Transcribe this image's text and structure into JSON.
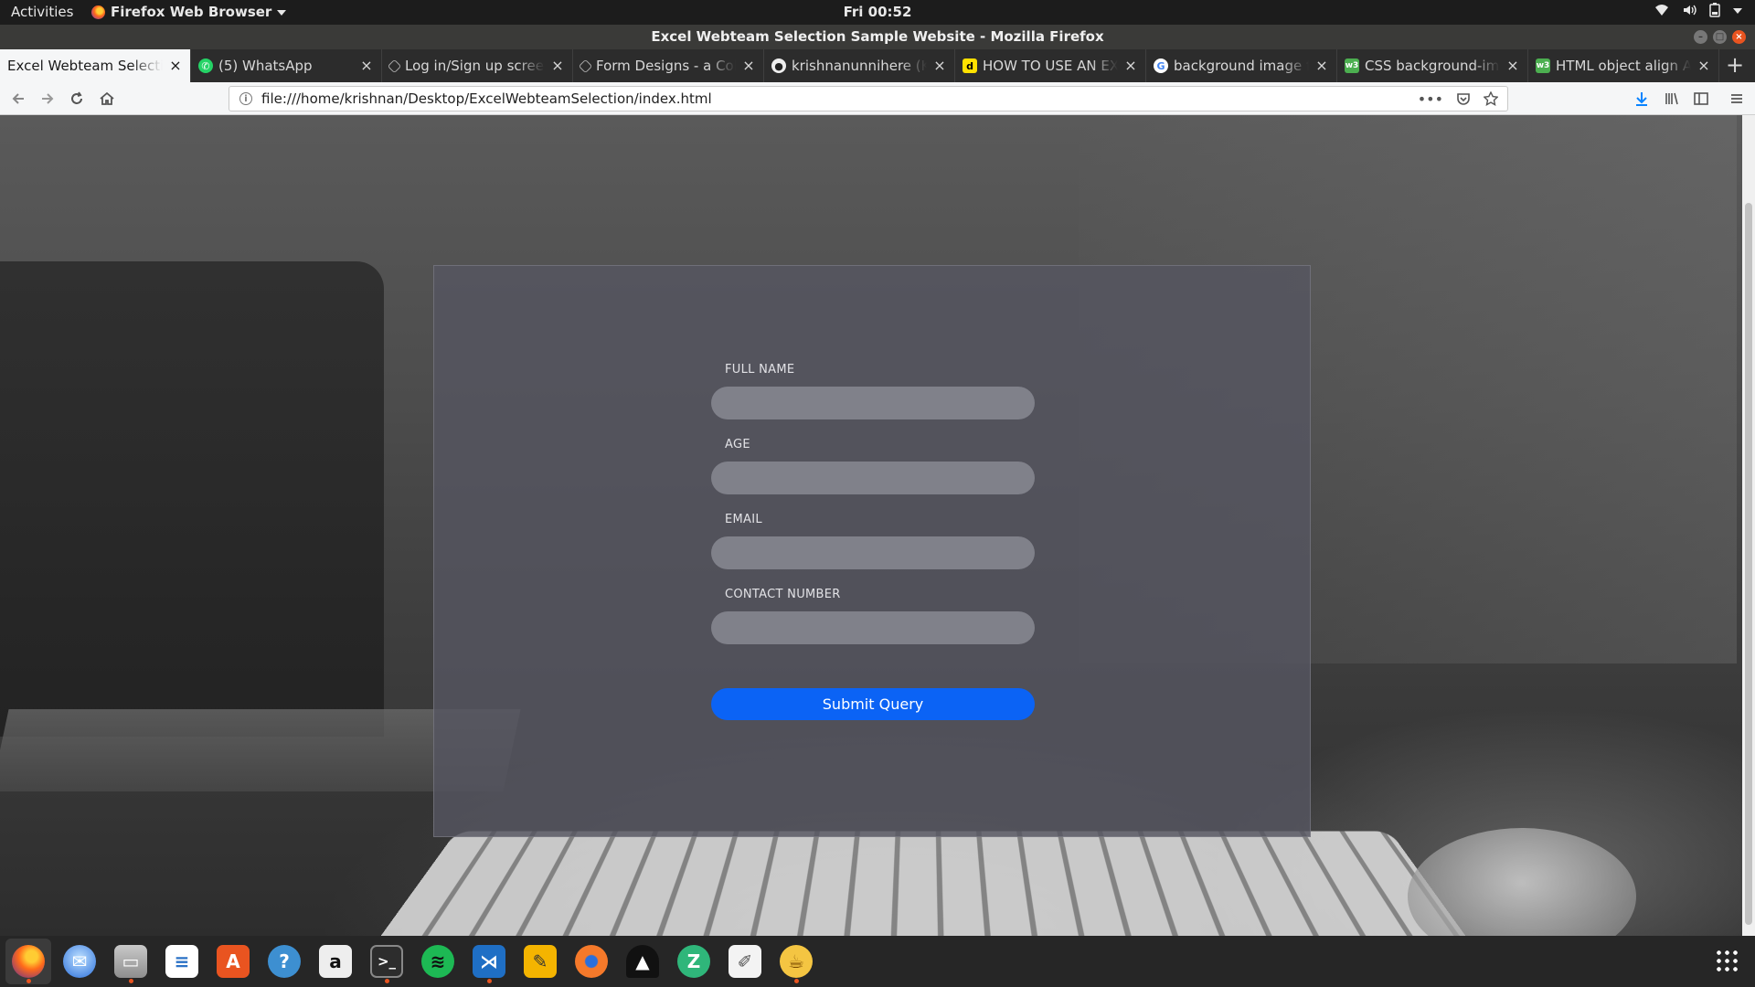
{
  "topbar": {
    "activities": "Activities",
    "app_name": "Firefox Web Browser",
    "clock": "Fri 00:52"
  },
  "window": {
    "title": "Excel Webteam Selection Sample Website - Mozilla Firefox"
  },
  "tabs": [
    {
      "label": "Excel Webteam Selection",
      "icon": "page-icon",
      "active": true
    },
    {
      "label": "(5) WhatsApp",
      "icon": "whatsapp-icon"
    },
    {
      "label": "Log in/Sign up screen",
      "icon": "codepen-icon"
    },
    {
      "label": "Form Designs - a Colle",
      "icon": "codepen-icon"
    },
    {
      "label": "krishnanunnihere (Kris",
      "icon": "github-icon"
    },
    {
      "label": "HOW TO USE AN EXTE",
      "icon": "d-icon"
    },
    {
      "label": "background image for",
      "icon": "google-icon"
    },
    {
      "label": "CSS background-imag",
      "icon": "w3schools-icon"
    },
    {
      "label": "HTML object align Att",
      "icon": "w3schools-icon"
    }
  ],
  "urlbar": {
    "url": "file:///home/krishnan/Desktop/ExcelWebteamSelection/index.html"
  },
  "form": {
    "fields": [
      {
        "label": "FULL NAME",
        "value": ""
      },
      {
        "label": "AGE",
        "value": ""
      },
      {
        "label": "EMAIL",
        "value": ""
      },
      {
        "label": "CONTACT NUMBER",
        "value": ""
      }
    ],
    "submit_label": "Submit Query"
  },
  "colors": {
    "submit_button": "#0b63f5",
    "panel": "#555660",
    "input": "#80818a",
    "ubuntu_accent": "#e95420"
  },
  "dock": [
    {
      "name": "firefox-icon",
      "active": true,
      "running": true
    },
    {
      "name": "thunderbird-icon"
    },
    {
      "name": "files-icon",
      "running": true
    },
    {
      "name": "writer-icon"
    },
    {
      "name": "software-center-icon"
    },
    {
      "name": "help-icon"
    },
    {
      "name": "amazon-icon"
    },
    {
      "name": "terminal-icon",
      "running": true
    },
    {
      "name": "spotify-icon"
    },
    {
      "name": "vscode-icon",
      "running": true
    },
    {
      "name": "sublime-icon"
    },
    {
      "name": "blender-icon"
    },
    {
      "name": "inkscape-icon"
    },
    {
      "name": "zeal-icon"
    },
    {
      "name": "text-editor-icon"
    },
    {
      "name": "genie-icon",
      "running": true
    }
  ]
}
